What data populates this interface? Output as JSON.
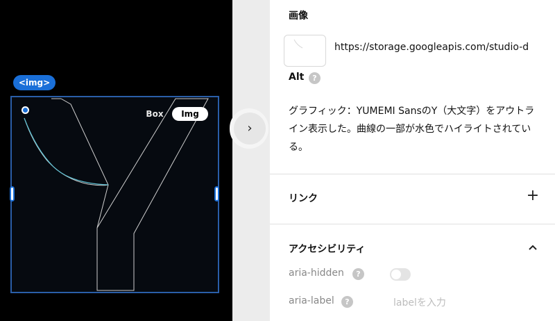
{
  "canvas": {
    "element_tag": "<img>",
    "mode_box": "Box",
    "mode_img": "Img",
    "accent_color": "#1a6fd8",
    "curve_highlight_color": "#5fc3d6"
  },
  "expand_button": {
    "icon": "chevron-right-icon",
    "glyph": "›"
  },
  "panel": {
    "image_section": {
      "title": "画像",
      "url": "https://storage.googleapis.com/studio-d",
      "alt_label": "Alt",
      "help_glyph": "?",
      "description": "グラフィック：YUMEMI SansのY（大文字）をアウトライン表示した。曲線の一部が水色でハイライトされている。"
    },
    "link_section": {
      "title": "リンク",
      "add_glyph": "+"
    },
    "accessibility_section": {
      "title": "アクセシビリティ",
      "aria_hidden_label": "aria-hidden",
      "aria_hidden_value": false,
      "aria_label_label": "aria-label",
      "aria_label_placeholder": "labelを入力",
      "help_glyph": "?"
    }
  }
}
